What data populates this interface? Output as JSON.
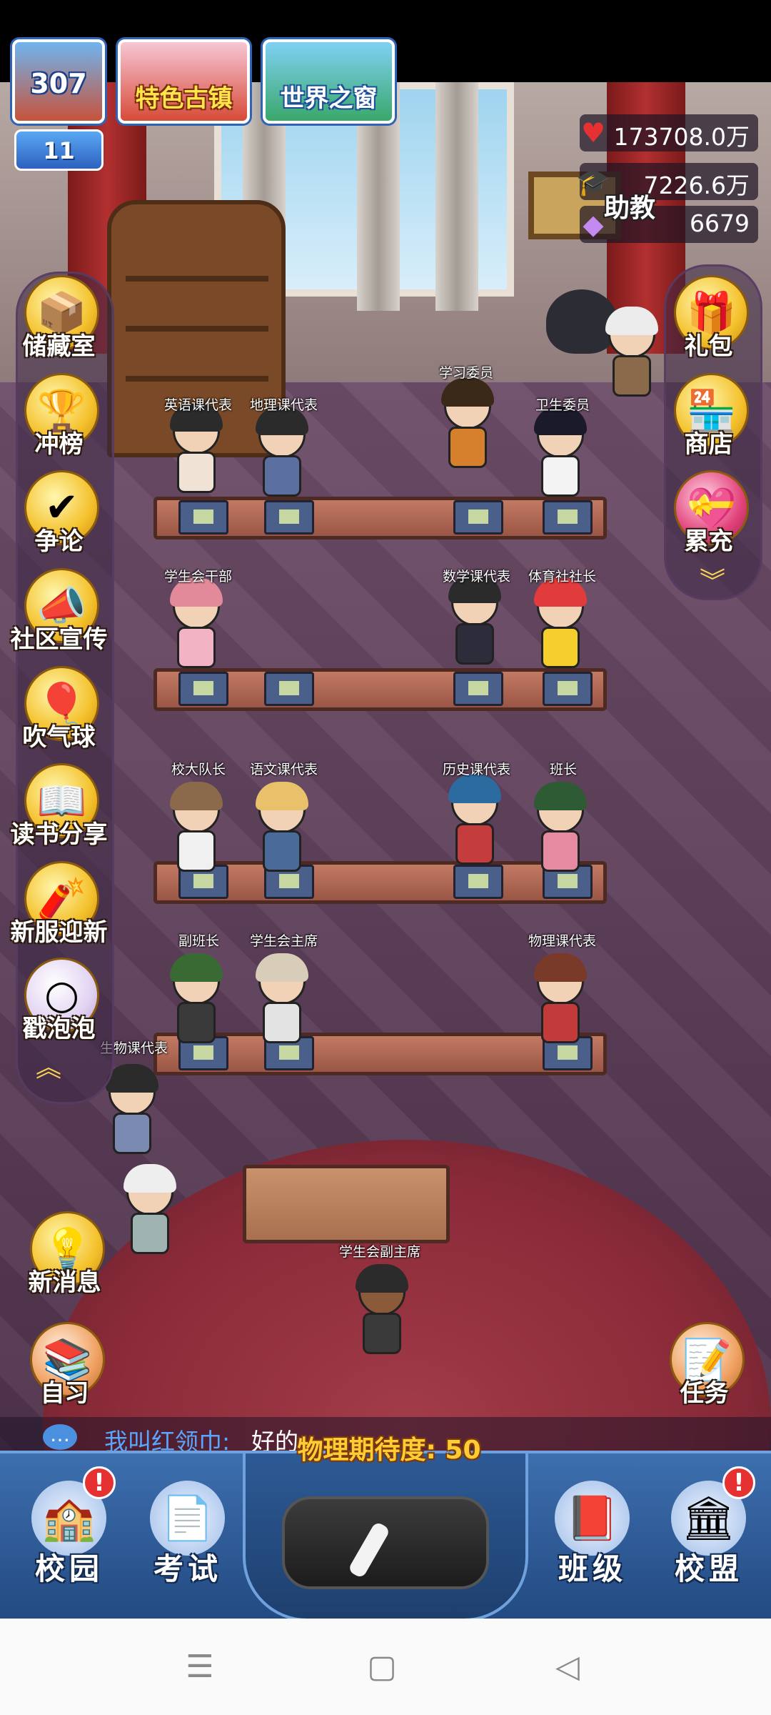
{
  "hud": {
    "campus_level": "307",
    "rank_level": "11",
    "featured_town": "特色古镇",
    "world_window": "世界之窗",
    "resources": [
      {
        "icon": "heart-icon",
        "value": "173708.0万"
      },
      {
        "icon": "graduation-cap-icon",
        "value": "7226.6万"
      },
      {
        "icon": "diamond-icon",
        "value": "6679"
      }
    ]
  },
  "left_menu": [
    {
      "label": "储藏室",
      "icon": "storage-box-icon"
    },
    {
      "label": "冲榜",
      "icon": "trophy-icon"
    },
    {
      "label": "争论",
      "icon": "debate-icon"
    },
    {
      "label": "社区宣传",
      "icon": "megaphone-icon"
    },
    {
      "label": "吹气球",
      "icon": "balloon-icon"
    },
    {
      "label": "读书分享",
      "icon": "book-icon"
    },
    {
      "label": "新服迎新",
      "icon": "firecracker-icon"
    },
    {
      "label": "戳泡泡",
      "icon": "bubble-icon"
    }
  ],
  "right_menu": [
    {
      "label": "礼包",
      "icon": "gift-box-icon"
    },
    {
      "label": "商店",
      "icon": "shop-icon"
    },
    {
      "label": "累充",
      "icon": "treasure-gift-icon"
    }
  ],
  "assistant_label": "助教",
  "news_button": "新消息",
  "self_study_button": "自习",
  "task_button": "任务",
  "roles": [
    "英语课代表",
    "地理课代表",
    "学习委员",
    "卫生委员",
    "学生会干部",
    "数学课代表",
    "体育社社长",
    "校大队长",
    "语文课代表",
    "历史课代表",
    "班长",
    "副班长",
    "学生会主席",
    "物理课代表",
    "生物课代表",
    "学生会副主席"
  ],
  "chat": {
    "name": "我叫红领巾:",
    "message": "好的"
  },
  "expectation": "物理期待度: 50",
  "bottom_nav": [
    {
      "label": "校园",
      "icon": "school-building-icon",
      "badge": "!"
    },
    {
      "label": "考试",
      "icon": "exam-paper-icon",
      "badge": ""
    },
    {
      "label": "班级",
      "icon": "class-book-icon",
      "badge": ""
    },
    {
      "label": "校盟",
      "icon": "alliance-school-icon",
      "badge": "!"
    }
  ]
}
